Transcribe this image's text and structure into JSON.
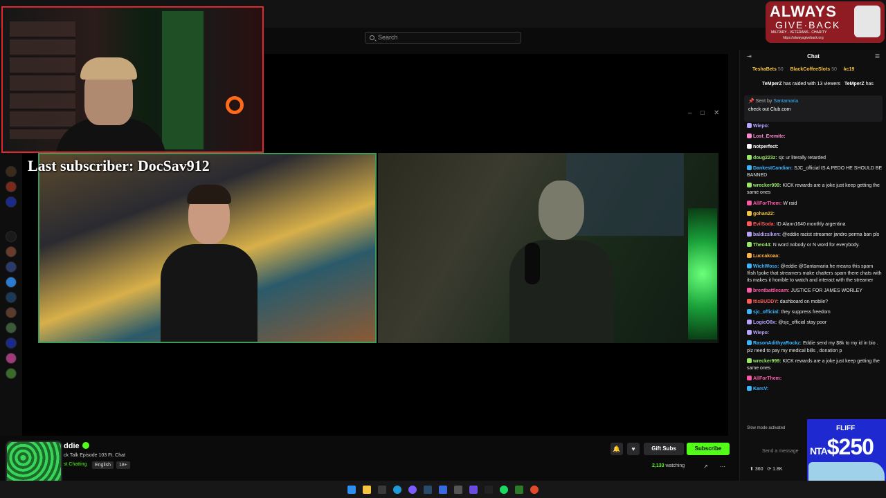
{
  "search": {
    "placeholder": "Search"
  },
  "overlay": {
    "last_subscriber": "Last subscriber: DocSav912"
  },
  "chat": {
    "title": "Chat",
    "gifters": [
      {
        "name": "TeshaBets",
        "count": "50"
      },
      {
        "name": "BlackCoffeeSlots",
        "count": "50"
      },
      {
        "name": "kc19",
        "count": ""
      }
    ],
    "raid": {
      "user": "TeMperZ",
      "text": "has raided with 13 viewers",
      "user2": "TeMperZ",
      "text2": "has"
    },
    "pinned": {
      "sent_by": "Sent by",
      "sender": "Santamaria",
      "message": "check out Club.com"
    },
    "messages": [
      {
        "user": "Wiepo:",
        "text": "",
        "color": "#b9a4ff"
      },
      {
        "user": "Lost_Eremite:",
        "text": "",
        "color": "#ff8ad1"
      },
      {
        "user": "notperfect:",
        "text": "",
        "color": "#ffffff"
      },
      {
        "user": "doug223z:",
        "text": "sjc ur literally retarded",
        "color": "#9ae86a"
      },
      {
        "user": "DankestCandian:",
        "text": "SJC_official IS A PEDO HE SHOULD BE BANNED",
        "color": "#3cb6ff"
      },
      {
        "user": "wrecker999:",
        "text": "KICK rewards are a joke just keep getting the same ones",
        "color": "#9ae86a"
      },
      {
        "user": "AllForThem:",
        "text": "W raid",
        "color": "#ff5aa8"
      },
      {
        "user": "gohan22:",
        "text": "",
        "color": "#f5c542"
      },
      {
        "user": "EvilSoda:",
        "text": "ID Alann1640 monthly argentina",
        "color": "#ff5a5a"
      },
      {
        "user": "baldizsIken:",
        "text": "@eddie racist streamer jandro perma ban pls",
        "color": "#b9a4ff"
      },
      {
        "user": "Theo44:",
        "text": "N word nobody or N word for everybody.",
        "color": "#9ae86a"
      },
      {
        "user": "Luccakoaa:",
        "text": "",
        "color": "#ffb347"
      },
      {
        "user": "WichWoss:",
        "text": "@eddie @Santamaria he means this spam !fish !poke that streamers make chatters spam there chats with its makes it horrible to watch and interact with the streamer",
        "color": "#3cb6ff"
      },
      {
        "user": "brentbattlecam:",
        "text": "JUSTICE FOR JAMES WORLEY",
        "color": "#ff5aa8"
      },
      {
        "user": "ItIsBUDDY:",
        "text": "dashboard on mobile?",
        "color": "#ff5a5a"
      },
      {
        "user": "sjc_official:",
        "text": "they suppress freedom",
        "color": "#3cb6ff"
      },
      {
        "user": "LogicO8x:",
        "text": "@sjc_official stay poor",
        "color": "#b9a4ff"
      },
      {
        "user": "Wiepo:",
        "text": "",
        "color": "#b9a4ff"
      },
      {
        "user": "RasonAdithyaRockz:",
        "text": "Eddie send my $8k to my id in bio . plz need to pay my medical bills , donation p",
        "color": "#3cb6ff"
      },
      {
        "user": "wrecker999:",
        "text": "KICK rewards are a joke just keep getting the same ones",
        "color": "#9ae86a"
      },
      {
        "user": "AllForThem:",
        "text": "",
        "color": "#ff5aa8"
      },
      {
        "user": "KarsV:",
        "text": "",
        "color": "#3cb6ff"
      }
    ],
    "slow_mode": "Slow mode activated",
    "send_placeholder": "Send a message",
    "stats": {
      "a": "360",
      "b": "1.8K"
    }
  },
  "channel": {
    "name": "ddie",
    "title": "ck Talk Episode 103 Ft. Chat",
    "category": "st Chatting",
    "tags": [
      "English",
      "18+"
    ],
    "gift_subs": "Gift Subs",
    "subscribe": "Subscribe",
    "viewers": "2,133",
    "watching": "watching"
  },
  "sponsor": {
    "line1": "ALWAYS",
    "line2": "GIVE·BACK",
    "line3": "MILITARY - VETERANS - CHARITY",
    "line4": "https://alwaysgiveback.org"
  },
  "fliff": {
    "logo": "FLIFF",
    "amount": "$250",
    "prefix": "NTA"
  },
  "colors": {
    "accent": "#53fc18",
    "cam_border": "#e0282e",
    "feed_border": "#3f9b5a"
  }
}
